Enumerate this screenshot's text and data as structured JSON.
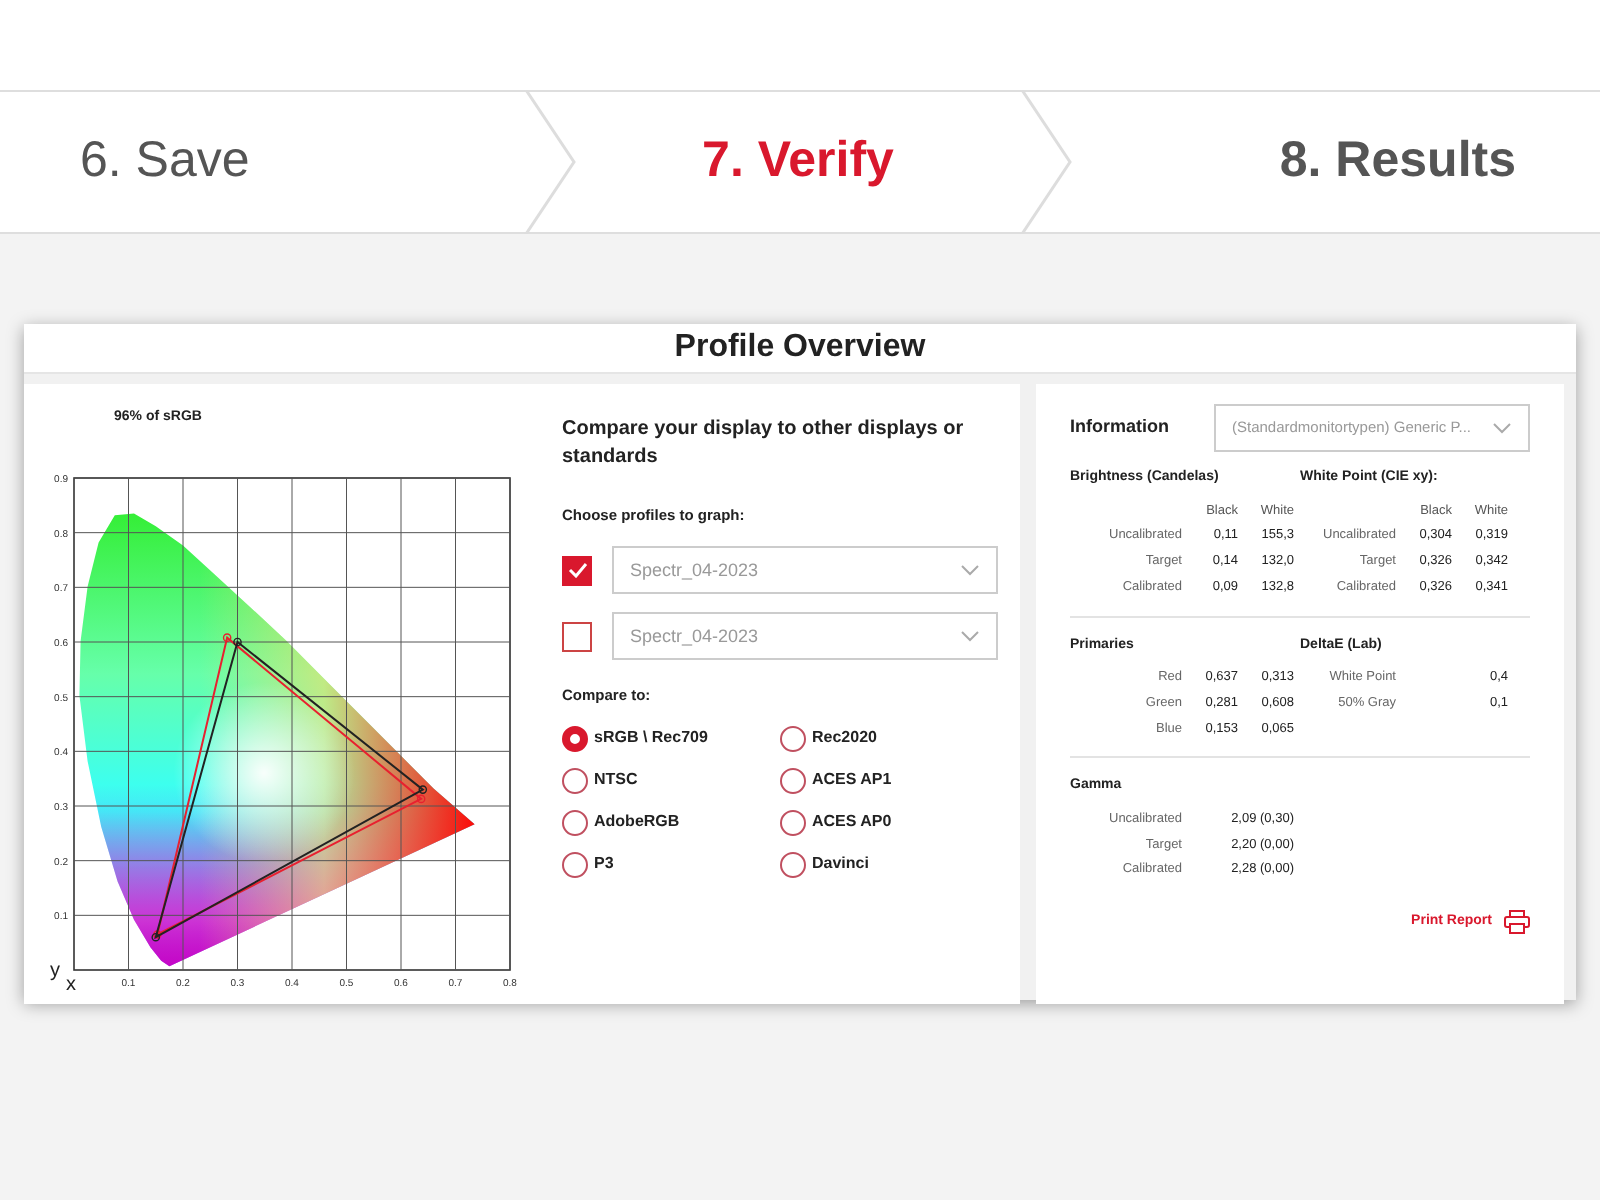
{
  "steps": [
    {
      "label": "6. Save",
      "kind": "done"
    },
    {
      "label": "7. Verify",
      "kind": "current"
    },
    {
      "label": "8. Results",
      "kind": "upcoming"
    }
  ],
  "card": {
    "title": "Profile Overview"
  },
  "chart": {
    "chart_data": {
      "type": "line",
      "title": "96% of sRGB",
      "xlabel": "x",
      "grid": true,
      "ylabel": "y",
      "xlim": [
        0,
        0.8
      ],
      "ylim": [
        0,
        0.9
      ],
      "xticks": [
        0.1,
        0.2,
        0.3,
        0.4,
        0.5,
        0.6,
        0.7,
        0.8
      ],
      "yticks": [
        0.1,
        0.2,
        0.3,
        0.4,
        0.5,
        0.6,
        0.7,
        0.8,
        0.9
      ]
    }
  },
  "compare": {
    "heading": "Compare your display to other displays or standards",
    "profiles_label": "Choose profiles to graph:",
    "profiles": [
      {
        "value": "Spectr_04-2023",
        "checked": true
      },
      {
        "value": "Spectr_04-2023",
        "checked": false
      }
    ],
    "compare_label": "Compare to:",
    "standards": [
      {
        "label": "sRGB \\ Rec709",
        "selected": true
      },
      {
        "label": "Rec2020",
        "selected": false
      },
      {
        "label": "NTSC",
        "selected": false
      },
      {
        "label": "ACES AP1",
        "selected": false
      },
      {
        "label": "AdobeRGB",
        "selected": false
      },
      {
        "label": "ACES AP0",
        "selected": false
      },
      {
        "label": "P3",
        "selected": false
      },
      {
        "label": "Davinci",
        "selected": false
      }
    ]
  },
  "information": {
    "title": "Information",
    "monitor": "(Standardmonitortypen) Generic P...",
    "brightness": {
      "title": "Brightness (Candelas)",
      "columns": [
        "Black",
        "White"
      ],
      "rows": [
        {
          "label": "Uncalibrated",
          "values": [
            "0,11",
            "155,3"
          ]
        },
        {
          "label": "Target",
          "values": [
            "0,14",
            "132,0"
          ]
        },
        {
          "label": "Calibrated",
          "values": [
            "0,09",
            "132,8"
          ]
        }
      ]
    },
    "white_point": {
      "title": "White Point (CIE xy):",
      "columns": [
        "Black",
        "White"
      ],
      "rows": [
        {
          "label": "Uncalibrated",
          "values": [
            "0,304",
            "0,319"
          ]
        },
        {
          "label": "Target",
          "values": [
            "0,326",
            "0,342"
          ]
        },
        {
          "label": "Calibrated",
          "values": [
            "0,326",
            "0,341"
          ]
        }
      ]
    },
    "primaries": {
      "title": "Primaries",
      "rows": [
        {
          "label": "Red",
          "values": [
            "0,637",
            "0,313"
          ]
        },
        {
          "label": "Green",
          "values": [
            "0,281",
            "0,608"
          ]
        },
        {
          "label": "Blue",
          "values": [
            "0,153",
            "0,065"
          ]
        }
      ]
    },
    "delta_e": {
      "title": "DeltaE (Lab)",
      "rows": [
        {
          "label": "White Point",
          "values": [
            "0,4"
          ]
        },
        {
          "label": "50% Gray",
          "values": [
            "0,1"
          ]
        }
      ]
    },
    "gamma": {
      "title": "Gamma",
      "rows": [
        {
          "label": "Uncalibrated",
          "values": [
            "2,09 (0,30)"
          ]
        },
        {
          "label": "Target",
          "values": [
            "2,20 (0,00)"
          ]
        },
        {
          "label": "Calibrated",
          "values": [
            "2,28 (0,00)"
          ]
        }
      ]
    },
    "print_report": "Print Report"
  }
}
